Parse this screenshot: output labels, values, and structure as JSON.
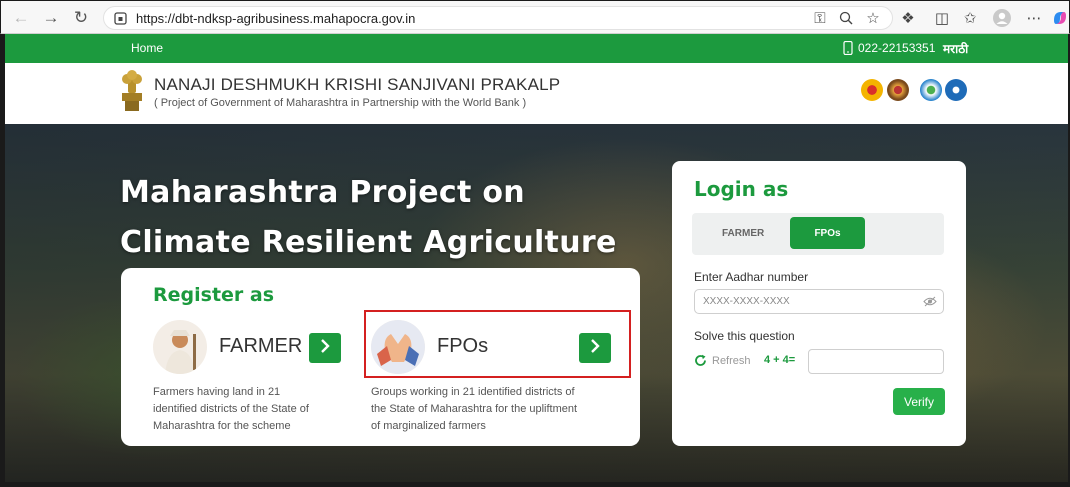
{
  "browser": {
    "url": "https://dbt-ndksp-agribusiness.mahapocra.gov.in",
    "icons": [
      "back-icon",
      "forward-icon",
      "refresh-icon",
      "site-info-icon",
      "key-icon",
      "zoom-icon",
      "favorite-icon",
      "extensions-icon",
      "split-screen-icon",
      "favorites-icon",
      "profile-icon",
      "more-icon",
      "copilot-icon"
    ]
  },
  "topnav": {
    "home": "Home",
    "phone": "022-22153351",
    "language": "मराठी"
  },
  "header": {
    "title": "NANAJI DESHMUKH KRISHI SANJIVANI PRAKALP",
    "subtitle": "( Project of Government of Maharashtra in Partnership with the World Bank )"
  },
  "hero": {
    "title_line1": "Maharashtra Project on",
    "title_line2": "Climate Resilient Agriculture"
  },
  "register": {
    "title": "Register as",
    "farmer": {
      "label": "FARMER",
      "desc_lines": [
        "Farmers having land in 21",
        "identified districts of the State of",
        "Maharashtra for the scheme"
      ]
    },
    "fpo": {
      "label": "FPOs",
      "desc_lines": [
        "Groups working in 21 identified districts of",
        "the State of Maharashtra for the upliftment",
        "of marginalized farmers"
      ]
    }
  },
  "login": {
    "title": "Login as",
    "tabs": {
      "farmer": "FARMER",
      "fpo": "FPOs",
      "selected": "FPOs"
    },
    "aadhar_label": "Enter Aadhar number",
    "aadhar_placeholder": "XXXX-XXXX-XXXX",
    "question_label": "Solve this question",
    "refresh": "Refresh",
    "captcha": "4 + 4=",
    "captcha_answer": "",
    "verify": "Verify"
  },
  "colors": {
    "brand_green": "#1c9a3e",
    "highlight_red": "#d42020"
  }
}
